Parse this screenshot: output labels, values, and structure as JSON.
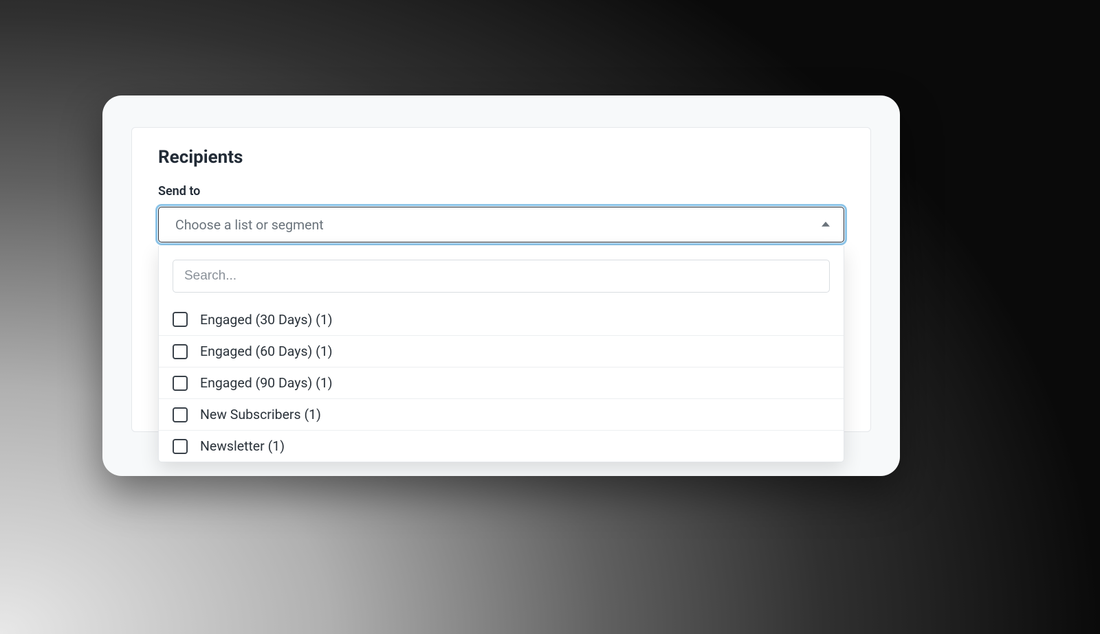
{
  "section": {
    "title": "Recipients",
    "field_label": "Send to"
  },
  "select": {
    "placeholder": "Choose a list or segment",
    "search_placeholder": "Search...",
    "options": [
      {
        "label": "Engaged (30 Days) (1)"
      },
      {
        "label": "Engaged (60 Days) (1)"
      },
      {
        "label": "Engaged (90 Days) (1)"
      },
      {
        "label": "New Subscribers (1)"
      },
      {
        "label": "Newsletter (1)"
      }
    ]
  }
}
